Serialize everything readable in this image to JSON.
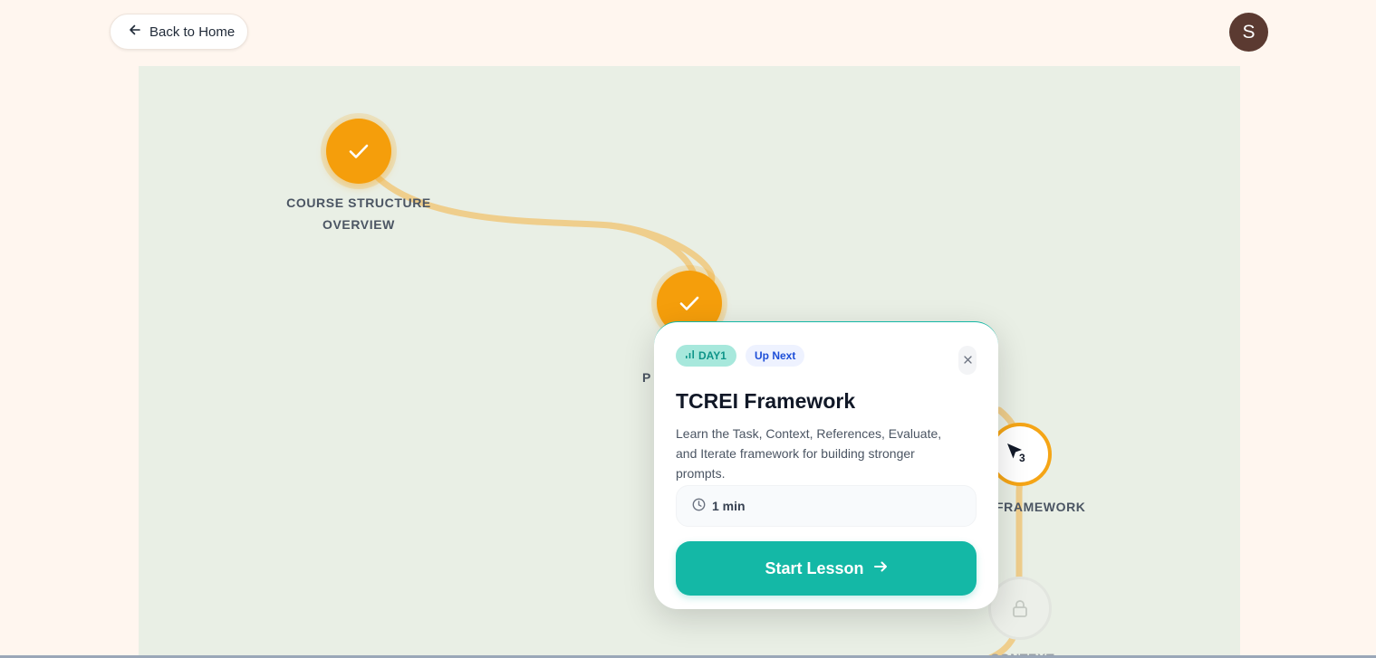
{
  "header": {
    "back_label": "Back to Home",
    "avatar_initial": "S"
  },
  "path": {
    "nodes": [
      {
        "state": "completed",
        "label_line1": "COURSE STRUCTURE",
        "label_line2": "OVERVIEW"
      },
      {
        "state": "completed",
        "label_partial": "P"
      },
      {
        "state": "current",
        "number": "3",
        "label": "FRAMEWORK"
      },
      {
        "state": "locked",
        "label_partial": "CONTEXT"
      }
    ]
  },
  "popup": {
    "day_badge": "DAY1",
    "status_badge": "Up Next",
    "title": "TCREI Framework",
    "description": "Learn the Task, Context, References, Evaluate, and Iterate framework for building stronger prompts.",
    "duration": "1 min",
    "start_label": "Start Lesson"
  },
  "icons": {
    "back": "arrow-left-icon",
    "check": "check-icon",
    "cursor": "cursor-arrow-icon",
    "lock": "lock-icon",
    "close": "close-icon",
    "clock": "clock-icon",
    "signal": "signal-bars-icon",
    "arrow": "arrow-right-icon"
  },
  "colors": {
    "completed": "#f59e0b",
    "accent": "#14b8a6",
    "path": "#efce8c",
    "map_bg": "#e9efe5",
    "page_bg": "#fff6ef"
  }
}
